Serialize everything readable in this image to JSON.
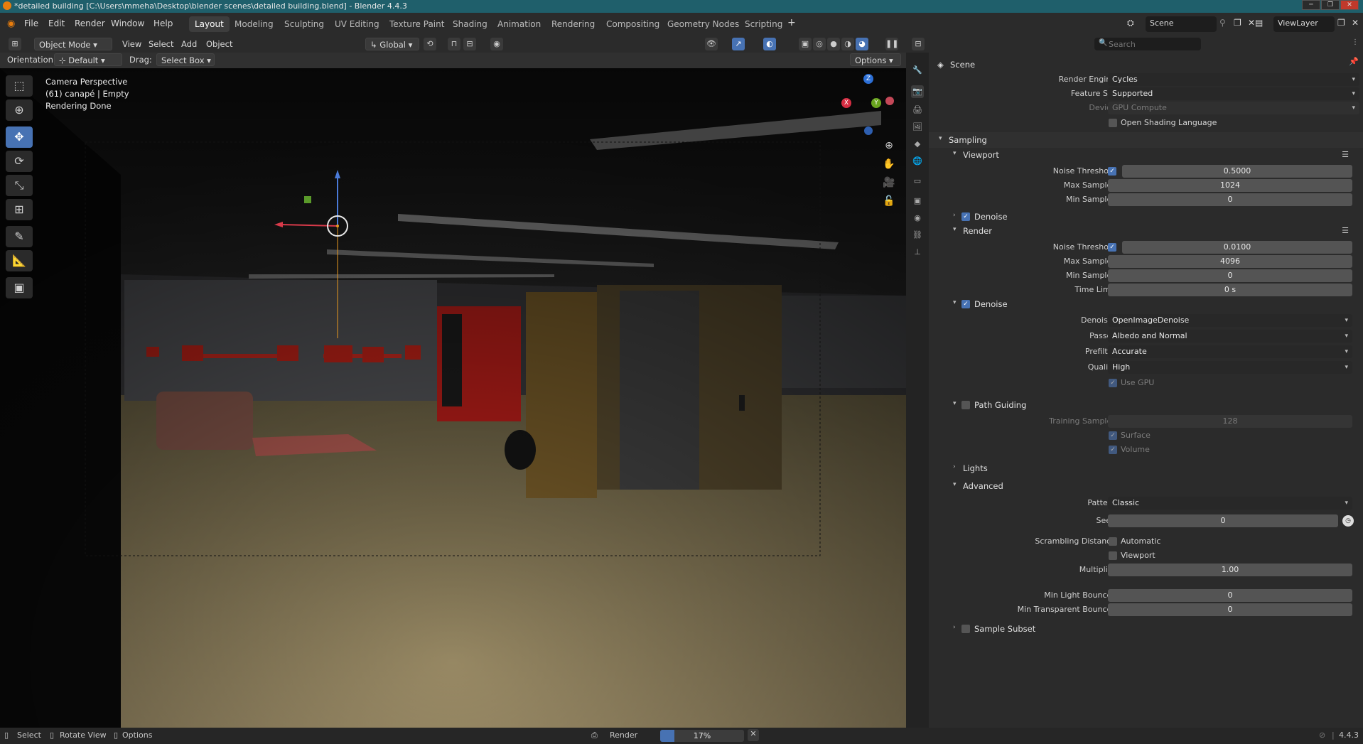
{
  "window": {
    "title": "*detailed building [C:\\Users\\mmeha\\Desktop\\blender scenes\\detailed building.blend] - Blender 4.4.3"
  },
  "menu": {
    "items": [
      "File",
      "Edit",
      "Render",
      "Window",
      "Help"
    ],
    "workspaces": [
      "Layout",
      "Modeling",
      "Sculpting",
      "UV Editing",
      "Texture Paint",
      "Shading",
      "Animation",
      "Rendering",
      "Compositing",
      "Geometry Nodes",
      "Scripting"
    ],
    "active_workspace": "Layout",
    "scene_name": "Scene",
    "view_layer": "ViewLayer"
  },
  "viewport_header": {
    "mode": "Object Mode",
    "menus": [
      "View",
      "Select",
      "Add",
      "Object"
    ],
    "transform_orientation": "Global",
    "orientation_label": "Orientation:",
    "orientation_value": "Default",
    "drag_label": "Drag:",
    "drag_value": "Select Box",
    "options_label": "Options"
  },
  "viewport_overlay": {
    "line1": "Camera Perspective",
    "line2": "(61) canapé | Empty",
    "line3": "Rendering Done",
    "gizmo_axes": [
      "X",
      "Y",
      "Z"
    ]
  },
  "properties": {
    "search_placeholder": "Search",
    "context": "Scene",
    "render_engine_label": "Render Engine",
    "render_engine": "Cycles",
    "feature_set_label": "Feature Set",
    "feature_set": "Supported",
    "device_label": "Device",
    "device": "GPU Compute",
    "osl_label": "Open Shading Language",
    "sampling": {
      "title": "Sampling",
      "viewport": {
        "title": "Viewport",
        "noise_threshold_label": "Noise Threshold",
        "noise_threshold": "0.5000",
        "max_samples_label": "Max Samples",
        "max_samples": "1024",
        "min_samples_label": "Min Samples",
        "min_samples": "0",
        "denoise_label": "Denoise"
      },
      "render": {
        "title": "Render",
        "noise_threshold_label": "Noise Threshold",
        "noise_threshold": "0.0100",
        "max_samples_label": "Max Samples",
        "max_samples": "4096",
        "min_samples_label": "Min Samples",
        "min_samples": "0",
        "time_limit_label": "Time Limit",
        "time_limit": "0 s"
      },
      "denoise": {
        "title": "Denoise",
        "denoiser_label": "Denoiser",
        "denoiser": "OpenImageDenoise",
        "passes_label": "Passes",
        "passes": "Albedo and Normal",
        "prefilter_label": "Prefilter",
        "prefilter": "Accurate",
        "quality_label": "Quality",
        "quality": "High",
        "use_gpu_label": "Use GPU"
      },
      "path_guiding": {
        "title": "Path Guiding",
        "training_samples_label": "Training Samples",
        "training_samples": "128",
        "surface_label": "Surface",
        "volume_label": "Volume"
      },
      "lights_title": "Lights",
      "advanced": {
        "title": "Advanced",
        "pattern_label": "Pattern",
        "pattern": "Classic",
        "seed_label": "Seed",
        "seed": "0",
        "scrambling_label": "Scrambling Distance",
        "automatic_label": "Automatic",
        "viewport_label": "Viewport",
        "multiplier_label": "Multiplier",
        "multiplier": "1.00",
        "min_light_bounces_label": "Min Light Bounces",
        "min_light_bounces": "0",
        "min_transparent_bounces_label": "Min Transparent Bounces",
        "min_transparent_bounces": "0"
      },
      "sample_subset_title": "Sample Subset"
    }
  },
  "status": {
    "select": "Select",
    "rotate": "Rotate View",
    "options": "Options",
    "job": "Render",
    "progress": 0.17,
    "progress_text": "17%",
    "version": "4.4.3"
  },
  "colors": {
    "accent": "#4772b3",
    "titlebar": "#1f5f6b",
    "panel": "#2b2b2b"
  }
}
